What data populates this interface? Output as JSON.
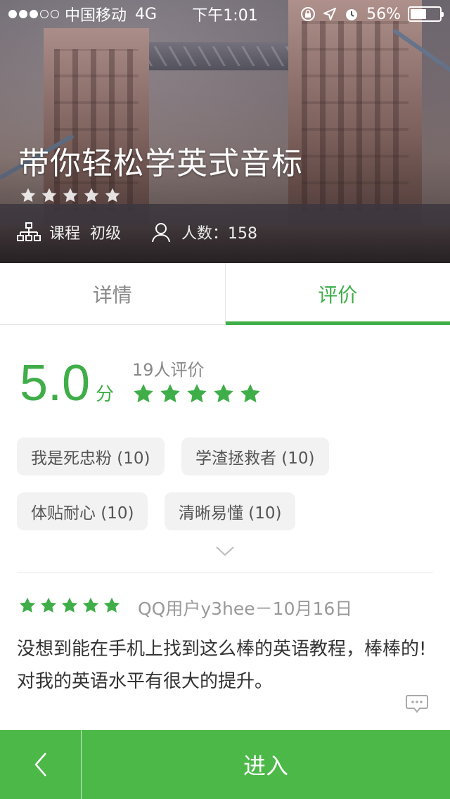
{
  "status_bar": {
    "carrier": "中国移动",
    "network": "4G",
    "time": "下午1:01",
    "battery": "56%",
    "battery_level": 0.56
  },
  "course": {
    "title": "带你轻松学英式音标",
    "rating_stars": 5,
    "type_label": "课程",
    "level": "初级",
    "students_label": "人数：158"
  },
  "tabs": [
    {
      "label": "详情",
      "active": false
    },
    {
      "label": "评价",
      "active": true
    }
  ],
  "rating": {
    "score": "5.0",
    "unit": "分",
    "count_label": "19人评价",
    "stars": 5
  },
  "tags": [
    {
      "label": "我是死忠粉 (10)"
    },
    {
      "label": "学渣拯救者 (10)"
    },
    {
      "label": "体贴耐心 (10)"
    },
    {
      "label": "清晰易懂 (10)"
    }
  ],
  "review": {
    "stars": 5,
    "user_date": "QQ用户y3hee－10月16日",
    "text": "没想到能在手机上找到这么棒的英语教程，棒棒的!对我的英语水平有很大的提升。"
  },
  "bottom_bar": {
    "enter_label": "进入"
  },
  "colors": {
    "accent": "#3fae49",
    "bar": "#4cb848"
  },
  "icons": [
    "signal-dots",
    "lock-rotation-icon",
    "location-icon",
    "alarm-icon",
    "battery-icon",
    "star-icon",
    "hierarchy-icon",
    "person-icon",
    "chevron-down-icon",
    "comment-icon",
    "back-arrow-icon"
  ]
}
